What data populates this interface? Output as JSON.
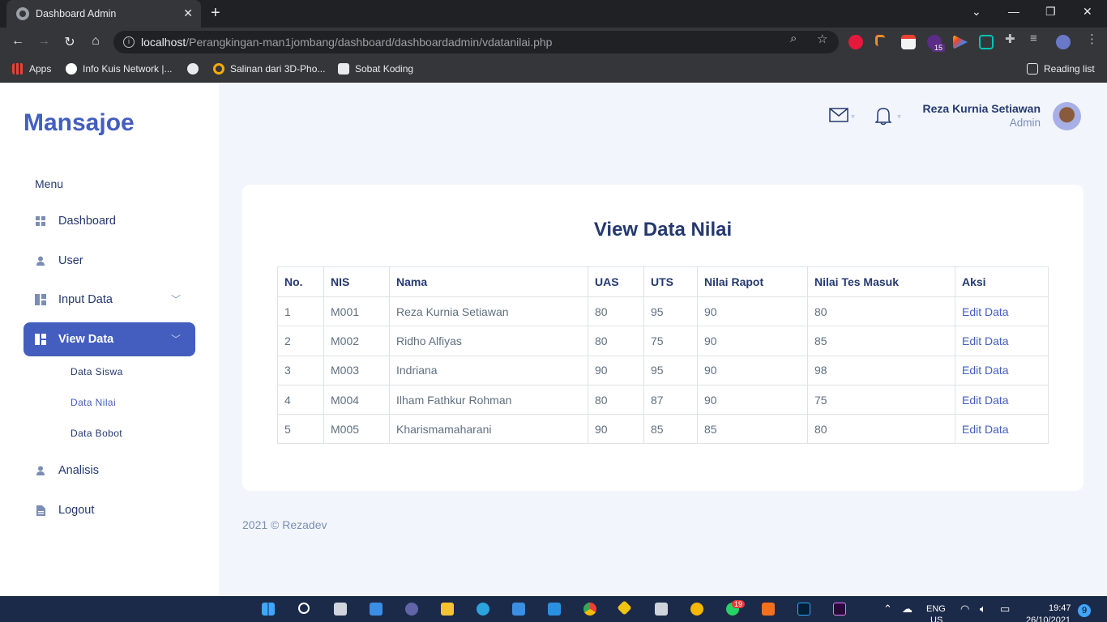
{
  "browser": {
    "tab_title": "Dashboard Admin",
    "new_tab": "+",
    "url_host": "localhost",
    "url_path": "/Perangkingan-man1jombang/dashboard/dashboardadmin/vdatanilai.php",
    "bookmarks": [
      "Apps",
      "Info Kuis Network |...",
      "Salinan dari 3D-Pho...",
      "Sobat Koding"
    ],
    "reading_list": "Reading list",
    "ext_badge": "15"
  },
  "sidebar": {
    "brand": "Mansajoe",
    "menu_title": "Menu",
    "items": [
      {
        "label": "Dashboard",
        "icon": "grid-icon"
      },
      {
        "label": "User",
        "icon": "person-icon"
      },
      {
        "label": "Input Data",
        "icon": "layout-icon"
      },
      {
        "label": "View Data",
        "icon": "layout-icon",
        "active": true
      },
      {
        "label": "Analisis",
        "icon": "person-icon"
      },
      {
        "label": "Logout",
        "icon": "file-icon"
      }
    ],
    "submenu": [
      "Data Siswa",
      "Data Nilai",
      "Data Bobot"
    ]
  },
  "header": {
    "user_name": "Reza Kurnia Setiawan",
    "user_role": "Admin"
  },
  "main": {
    "title": "View Data Nilai",
    "table": {
      "headers": [
        "No.",
        "NIS",
        "Nama",
        "UAS",
        "UTS",
        "Nilai Rapot",
        "Nilai Tes Masuk",
        "Aksi"
      ],
      "rows": [
        [
          "1",
          "M001",
          "Reza Kurnia Setiawan",
          "80",
          "95",
          "90",
          "80",
          "Edit Data"
        ],
        [
          "2",
          "M002",
          "Ridho Alfiyas",
          "80",
          "75",
          "90",
          "85",
          "Edit Data"
        ],
        [
          "3",
          "M003",
          "Indriana",
          "90",
          "95",
          "90",
          "98",
          "Edit Data"
        ],
        [
          "4",
          "M004",
          "Ilham Fathkur Rohman",
          "80",
          "87",
          "90",
          "75",
          "Edit Data"
        ],
        [
          "5",
          "M005",
          "Kharismamaharani",
          "90",
          "85",
          "85",
          "80",
          "Edit Data"
        ]
      ]
    }
  },
  "footer": {
    "text": "2021 © Rezadev"
  },
  "taskbar": {
    "lang": "ENG",
    "region": "US",
    "time": "19:47",
    "date": "26/10/2021",
    "notif_count": "9",
    "whatsapp_badge": "19"
  },
  "colors": {
    "accent": "#435ebe",
    "heading": "#25396f",
    "background": "#f2f6fc"
  }
}
